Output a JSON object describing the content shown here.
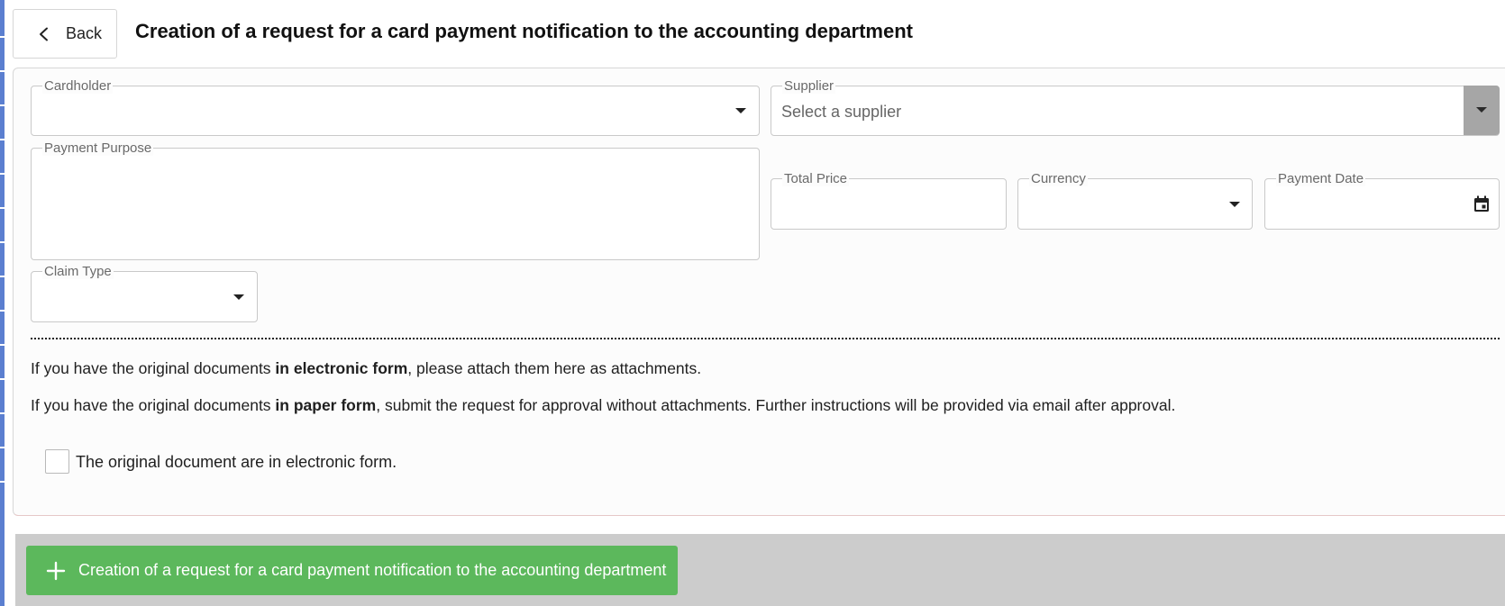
{
  "header": {
    "back_label": "Back",
    "title": "Creation of a request for a card payment notification to the accounting department"
  },
  "form": {
    "cardholder": {
      "label": "Cardholder",
      "value": ""
    },
    "supplier": {
      "label": "Supplier",
      "placeholder": "Select a supplier"
    },
    "payment_purpose": {
      "label": "Payment Purpose",
      "value": ""
    },
    "total_price": {
      "label": "Total Price",
      "value": ""
    },
    "currency": {
      "label": "Currency",
      "value": ""
    },
    "payment_date": {
      "label": "Payment Date",
      "value": ""
    },
    "claim_type": {
      "label": "Claim Type",
      "value": ""
    }
  },
  "info": {
    "line1_prefix": "If you have the original documents ",
    "line1_bold": "in electronic form",
    "line1_suffix": ", please attach them here as attachments.",
    "line2_prefix": "If you have the original documents ",
    "line2_bold": "in paper form",
    "line2_suffix": ", submit the request for approval without attachments. Further instructions will be provided via email after approval."
  },
  "electronic_checkbox": {
    "label": "The original document are in electronic form.",
    "checked": false
  },
  "footer": {
    "submit_label": "Creation of a request for a card payment notification to the accounting department"
  },
  "colors": {
    "accent_strip": "#5b7fd0",
    "submit_button": "#5cb85c",
    "footer_bar": "#cccccc",
    "supplier_dropdown_button": "#a6a6a6"
  },
  "icons": {
    "back": "chevron-left-icon",
    "dropdown": "caret-down-icon",
    "date": "calendar-icon",
    "submit": "plus-icon"
  }
}
